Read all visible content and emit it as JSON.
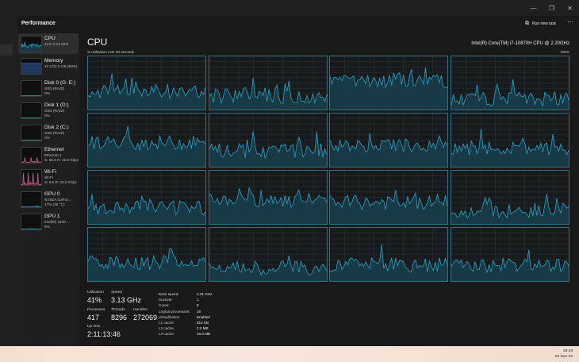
{
  "app": {
    "title": "Performance",
    "run_new_task": "Run new task",
    "more_label": "···"
  },
  "window_controls": [
    "—",
    "❐",
    "✕"
  ],
  "sidebar": [
    {
      "name": "CPU",
      "sub1": "41% 3.13 GHz",
      "sub2": "",
      "sub3": "",
      "active": true,
      "kind": "cpu"
    },
    {
      "name": "Memory",
      "sub1": "22.1/31.8 GB (69%)",
      "sub2": "",
      "sub3": "",
      "active": false,
      "kind": "memory"
    },
    {
      "name": "Disk 0 (G: E:)",
      "sub1": "SSD (RAID)",
      "sub2": "0%",
      "sub3": "",
      "active": false,
      "kind": "disk"
    },
    {
      "name": "Disk 1 (D:)",
      "sub1": "SSD (RAID)",
      "sub2": "0%",
      "sub3": "",
      "active": false,
      "kind": "disk"
    },
    {
      "name": "Disk 2 (C:)",
      "sub1": "SSD (RAID)",
      "sub2": "0%",
      "sub3": "",
      "active": false,
      "kind": "disk"
    },
    {
      "name": "Ethernet",
      "sub1": "Ethernet 4",
      "sub2": "S: 56.0 R: 40.0 Kbps",
      "sub3": "",
      "active": false,
      "kind": "net"
    },
    {
      "name": "Wi-Fi",
      "sub1": "Wi-Fi",
      "sub2": "S: 8.0 R: 24.0 Kbps",
      "sub3": "",
      "active": false,
      "kind": "net"
    },
    {
      "name": "GPU 0",
      "sub1": "NVIDIA GeFor...",
      "sub2": "17% (48 °C)",
      "sub3": "",
      "active": false,
      "kind": "gpu"
    },
    {
      "name": "GPU 1",
      "sub1": "Intel(R) UHD ...",
      "sub2": "8%",
      "sub3": "",
      "active": false,
      "kind": "gpu"
    }
  ],
  "main": {
    "title": "CPU",
    "cpu_name": "Intel(R) Core(TM) i7-10870H CPU @ 2.20GHz",
    "util_label": "% Utilization over 60 seconds",
    "max_label": "100%"
  },
  "stats": {
    "utilization_label": "Utilization",
    "utilization": "41%",
    "speed_label": "Speed",
    "speed": "3.13 GHz",
    "processes_label": "Processes",
    "processes": "417",
    "threads_label": "Threads",
    "threads": "8296",
    "handles_label": "Handles",
    "handles": "272069",
    "uptime_label": "Up time",
    "uptime": "2:11:13:46"
  },
  "specs": [
    {
      "k": "Base speed:",
      "v": "2.21 GHz"
    },
    {
      "k": "Sockets:",
      "v": "1"
    },
    {
      "k": "Cores:",
      "v": "8"
    },
    {
      "k": "Logical processors:",
      "v": "16"
    },
    {
      "k": "Virtualization:",
      "v": "Enabled"
    },
    {
      "k": "L1 cache:",
      "v": "512 KB"
    },
    {
      "k": "L2 cache:",
      "v": "2.0 MB"
    },
    {
      "k": "L3 cache:",
      "v": "16.0 MB"
    }
  ],
  "core_levels": [
    0.35,
    0.25,
    0.55,
    0.2,
    0.45,
    0.3,
    0.4,
    0.35,
    0.3,
    0.45,
    0.4,
    0.25,
    0.35,
    0.25,
    0.3,
    0.3
  ],
  "taskbar": {
    "time": "05:48",
    "date": "02-Mar-25"
  },
  "colors": {
    "accent": "#29a3c7",
    "fill": "#173a46",
    "wifi": "#c75d8f",
    "memory": "#3a6ac7"
  }
}
